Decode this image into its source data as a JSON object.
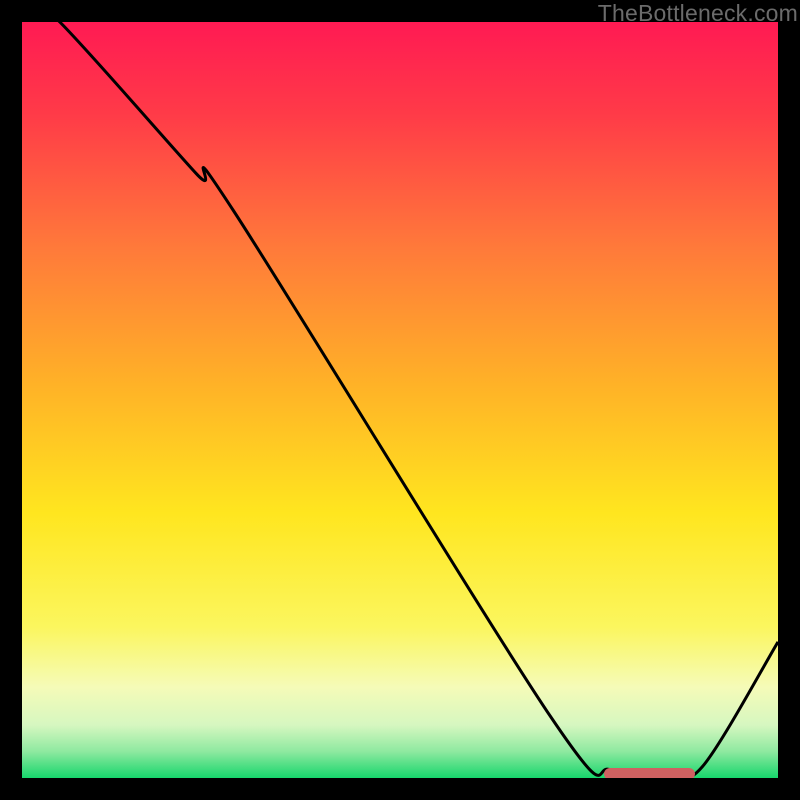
{
  "watermark": "TheBottleneck.com",
  "chart_data": {
    "type": "line",
    "title": "",
    "xlabel": "",
    "ylabel": "",
    "xlim": [
      0,
      100
    ],
    "ylim": [
      0,
      100
    ],
    "grid": false,
    "legend": false,
    "series": [
      {
        "name": "bottleneck-curve",
        "x": [
          0,
          5,
          23,
          28,
          70,
          78,
          85,
          90,
          100
        ],
        "y": [
          103,
          100,
          80,
          75,
          8,
          1,
          0.5,
          1.5,
          18
        ]
      }
    ],
    "optimal_marker": {
      "x_start": 77,
      "x_end": 89,
      "y": 0.5
    },
    "gradient_stops": [
      {
        "offset": 0.0,
        "color": "#ff1a53"
      },
      {
        "offset": 0.12,
        "color": "#ff3a48"
      },
      {
        "offset": 0.3,
        "color": "#ff7a3a"
      },
      {
        "offset": 0.48,
        "color": "#ffb227"
      },
      {
        "offset": 0.65,
        "color": "#ffe61f"
      },
      {
        "offset": 0.8,
        "color": "#fbf65e"
      },
      {
        "offset": 0.88,
        "color": "#f5fbb8"
      },
      {
        "offset": 0.93,
        "color": "#d6f7c0"
      },
      {
        "offset": 0.965,
        "color": "#8ee9a0"
      },
      {
        "offset": 1.0,
        "color": "#17d66c"
      }
    ]
  },
  "colors": {
    "curve": "#000000",
    "marker": "#cf6161",
    "frame": "#000000",
    "watermark": "#6b6b6b"
  }
}
